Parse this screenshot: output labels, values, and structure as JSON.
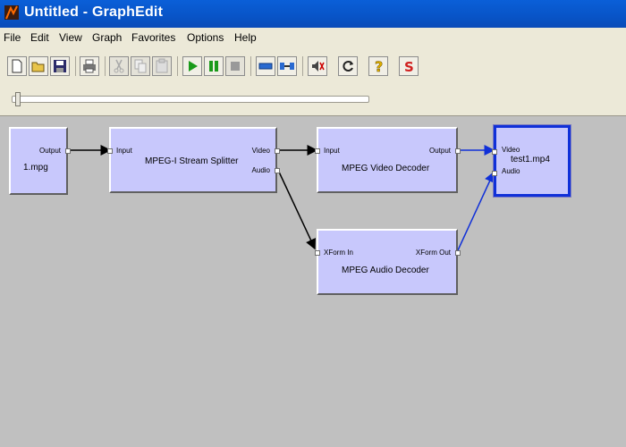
{
  "window": {
    "title": "Untitled - GraphEdit"
  },
  "menu": [
    "File",
    "Edit",
    "View",
    "Graph",
    "Favorites",
    "Options",
    "Help"
  ],
  "toolbar": {
    "buttons": [
      "new-icon",
      "open-icon",
      "save-icon",
      "print-icon",
      "cut-icon",
      "copy-icon",
      "paste-icon",
      "play-icon",
      "pause-icon",
      "stop-icon",
      "seek-icon",
      "connect-icon",
      "mute-icon",
      "refresh-icon",
      "help-icon",
      "s-icon"
    ]
  },
  "filters": {
    "source": {
      "name": "1.mpg",
      "out_pin": "Output"
    },
    "splitter": {
      "name": "MPEG-I Stream Splitter",
      "in_pin": "Input",
      "out_video": "Video",
      "out_audio": "Audio"
    },
    "video_decoder": {
      "name": "MPEG Video Decoder",
      "in_pin": "Input",
      "out_pin": "Output"
    },
    "audio_decoder": {
      "name": "MPEG Audio Decoder",
      "in_pin": "XForm In",
      "out_pin": "XForm Out"
    },
    "renderer": {
      "name": "test1.mp4",
      "in_video": "Video",
      "in_audio": "Audio"
    }
  },
  "colors": {
    "filter_fill": "#c8c8fc",
    "selected_border": "#1030d8",
    "wire_black": "#000000",
    "wire_blue": "#1030d8"
  }
}
